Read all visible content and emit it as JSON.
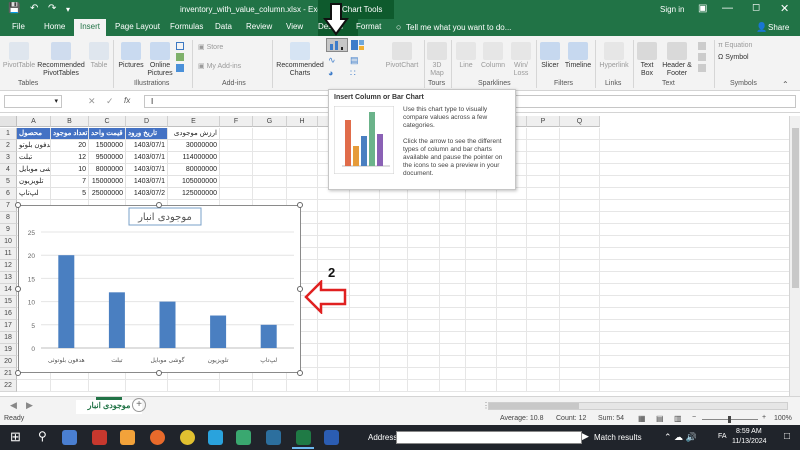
{
  "window": {
    "filename": "inventory_with_value_column.xlsx - Excel",
    "context_tab": "Chart Tools",
    "sign_in": "Sign in",
    "share": "Share"
  },
  "tabs": [
    {
      "label": "File"
    },
    {
      "label": "Home"
    },
    {
      "label": "Insert"
    },
    {
      "label": "Page Layout"
    },
    {
      "label": "Formulas"
    },
    {
      "label": "Data"
    },
    {
      "label": "Review"
    },
    {
      "label": "View"
    },
    {
      "label": "Design"
    },
    {
      "label": "Format"
    }
  ],
  "tell_me": "Tell me what you want to do...",
  "ribbon": {
    "pivottable": "PivotTable",
    "recommended_pivot": "Recommended PivotTables",
    "table": "Table",
    "pictures": "Pictures",
    "online_pictures": "Online Pictures",
    "store": "Store",
    "my_addins": "My Add-ins",
    "recommended_charts": "Recommended Charts",
    "pivotchart": "PivotChart",
    "map3d": "3D Map",
    "line": "Line",
    "column": "Column",
    "winloss": "Win/ Loss",
    "slicer": "Slicer",
    "timeline": "Timeline",
    "hyperlink": "Hyperlink",
    "textbox": "Text Box",
    "header_footer": "Header & Footer",
    "equation": "Equation",
    "symbol": "Symbol",
    "groups": {
      "tables": "Tables",
      "illustrations": "Illustrations",
      "addins": "Add-ins",
      "tours": "Tours",
      "sparklines": "Sparklines",
      "filters": "Filters",
      "links": "Links",
      "text": "Text",
      "symbols": "Symbols"
    }
  },
  "tooltip": {
    "title": "Insert Column or Bar Chart",
    "line1": "Use this chart type to visually compare values across a few categories.",
    "line2": "Click the arrow to see the different types of column and bar charts available and pause the pointer on the icons to see a preview in your document."
  },
  "formula_bar": {
    "name_box": "",
    "fx": "fx",
    "content": "I"
  },
  "columns": [
    "A",
    "B",
    "C",
    "D",
    "E",
    "F",
    "G",
    "H",
    "I",
    "J",
    "K",
    "L",
    "M",
    "N",
    "O",
    "P",
    "Q"
  ],
  "rows": [
    "1",
    "2",
    "3",
    "4",
    "5",
    "6",
    "7",
    "8",
    "9",
    "10",
    "11",
    "12",
    "13",
    "14",
    "15",
    "16",
    "17",
    "18",
    "19",
    "20",
    "21",
    "22"
  ],
  "table": {
    "headers": [
      "محصول",
      "تعداد موجود",
      "قیمت واحد",
      "تاریخ ورود",
      "ارزش موجودی"
    ],
    "rows": [
      [
        "هدفون بلوتو",
        "20",
        "1500000",
        "1403/07/1",
        "30000000"
      ],
      [
        "تبلت",
        "12",
        "9500000",
        "1403/07/1",
        "114000000"
      ],
      [
        "گوشی موبایل",
        "10",
        "8000000",
        "1403/07/1",
        "80000000"
      ],
      [
        "تلویزیون",
        "7",
        "15000000",
        "1403/07/1",
        "105000000"
      ],
      [
        "لپ‌تاپ",
        "5",
        "25000000",
        "1403/07/2",
        "125000000"
      ]
    ]
  },
  "annotation": {
    "number": "2"
  },
  "chart_data": {
    "type": "bar",
    "title": "موجودی انبار",
    "categories": [
      "هدفون بلوتوثی",
      "تبلت",
      "گوشی موبایل",
      "تلویزیون",
      "لپ‌تاپ"
    ],
    "values": [
      20,
      12,
      10,
      7,
      5
    ],
    "ylim": [
      0,
      25
    ],
    "yticks": [
      "0",
      "5",
      "10",
      "15",
      "20",
      "25"
    ],
    "color": "#4a7fc1",
    "grid": true
  },
  "sheet_tab": "موجودی انبار",
  "status": {
    "ready": "Ready",
    "average": "Average: 10.8",
    "count": "Count: 12",
    "sum": "Sum: 54",
    "zoom": "100%"
  },
  "taskbar": {
    "address_label": "Address",
    "match": "Match results",
    "lang": "FA",
    "time": "8:59 AM",
    "date": "11/13/2024"
  },
  "colors": {
    "excel_green": "#217346",
    "header_blue": "#4472c4",
    "arrow_red": "#e02020"
  }
}
